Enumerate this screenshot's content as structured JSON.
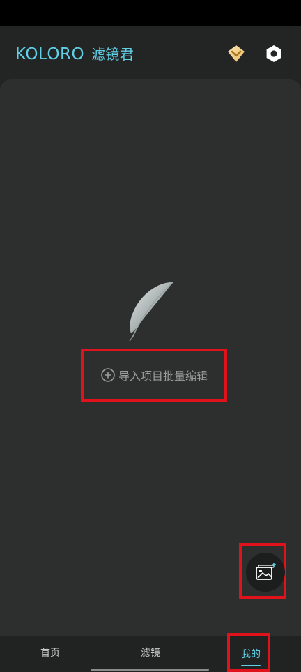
{
  "header": {
    "title_en": "KOLORO",
    "title_cn": "滤镜君",
    "vip_icon": "vip-diamond-icon",
    "settings_icon": "settings-icon"
  },
  "main": {
    "empty_icon": "feather-icon",
    "import_label": "导入项目批量编辑",
    "import_icon": "plus-circle-icon",
    "fab_icon": "add-image-icon"
  },
  "bottom_nav": {
    "items": [
      {
        "label": "首页",
        "active": false
      },
      {
        "label": "滤镜",
        "active": false
      },
      {
        "label": "我的",
        "active": true
      }
    ]
  },
  "colors": {
    "accent": "#5fd0e6",
    "background": "#2d2f2f",
    "highlight_box": "#e0121c"
  }
}
